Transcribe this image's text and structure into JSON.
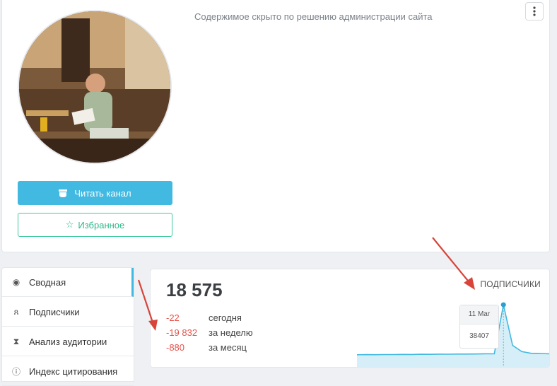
{
  "profile": {
    "hidden_note": "Содержимое скрыто по решению администрации сайта",
    "read_button_label": "Читать канал",
    "favorite_button_label": "Избранное"
  },
  "sidebar": {
    "items": [
      {
        "label": "Сводная",
        "icon": "dashboard-icon"
      },
      {
        "label": "Подписчики",
        "icon": "users-icon"
      },
      {
        "label": "Анализ аудитории",
        "icon": "hourglass-icon"
      },
      {
        "label": "Индекс цитирования",
        "icon": "info-icon"
      }
    ]
  },
  "stats": {
    "subscribers": "18 575",
    "subscribers_label": "ПОДПИСЧИКИ",
    "deltas": [
      {
        "value": "-22",
        "label": "сегодня"
      },
      {
        "value": "-19 832",
        "label": "за неделю"
      },
      {
        "value": "-880",
        "label": "за месяц"
      }
    ],
    "tooltip": {
      "date": "11 Mar",
      "value": "38407"
    }
  },
  "colors": {
    "primary": "#42b9e1",
    "accent_green": "#3ec9a0",
    "negative": "#e5534b",
    "annotation_arrow": "#d8443a"
  },
  "chart_data": {
    "type": "area",
    "series": [
      {
        "values": [
          18200,
          18250,
          18230,
          18300,
          18280,
          18350,
          18320,
          18400,
          18380,
          18450,
          18430,
          18500,
          18480,
          18520,
          18600,
          18560,
          38407,
          22000,
          19500,
          18800,
          18700,
          18575
        ]
      }
    ],
    "tooltip_point": {
      "x": "11 Mar",
      "y": 38407
    }
  }
}
